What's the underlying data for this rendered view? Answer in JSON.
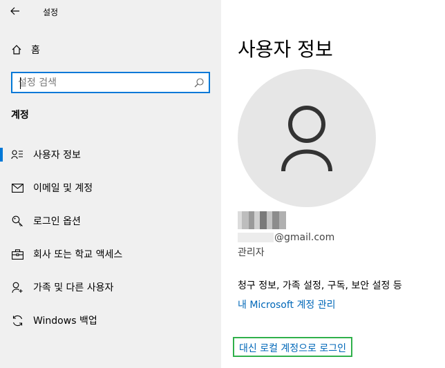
{
  "window": {
    "title": "설정"
  },
  "sidebar": {
    "home_label": "홈",
    "search": {
      "placeholder": "설정 검색",
      "value": ""
    },
    "section_title": "계정",
    "items": [
      {
        "label": "사용자 정보",
        "icon": "person-list-icon",
        "selected": true
      },
      {
        "label": "이메일 및 계정",
        "icon": "mail-icon",
        "selected": false
      },
      {
        "label": "로그인 옵션",
        "icon": "key-icon",
        "selected": false
      },
      {
        "label": "회사 또는 학교 액세스",
        "icon": "briefcase-icon",
        "selected": false
      },
      {
        "label": "가족 및 다른 사용자",
        "icon": "person-add-icon",
        "selected": false
      },
      {
        "label": "Windows 백업",
        "icon": "sync-icon",
        "selected": false
      }
    ]
  },
  "main": {
    "title": "사용자 정보",
    "email_suffix": "@gmail.com",
    "role": "관리자",
    "billing_text": "청구 정보, 가족 설정, 구독, 보안 설정 등",
    "manage_link": "내 Microsoft 계정 관리",
    "local_signin_link": "대신 로컬 계정으로 로그인"
  },
  "colors": {
    "accent": "#0078d7",
    "link": "#0067b8",
    "highlight_border": "#2fb04a",
    "sidebar_bg": "#f0f0f0"
  }
}
